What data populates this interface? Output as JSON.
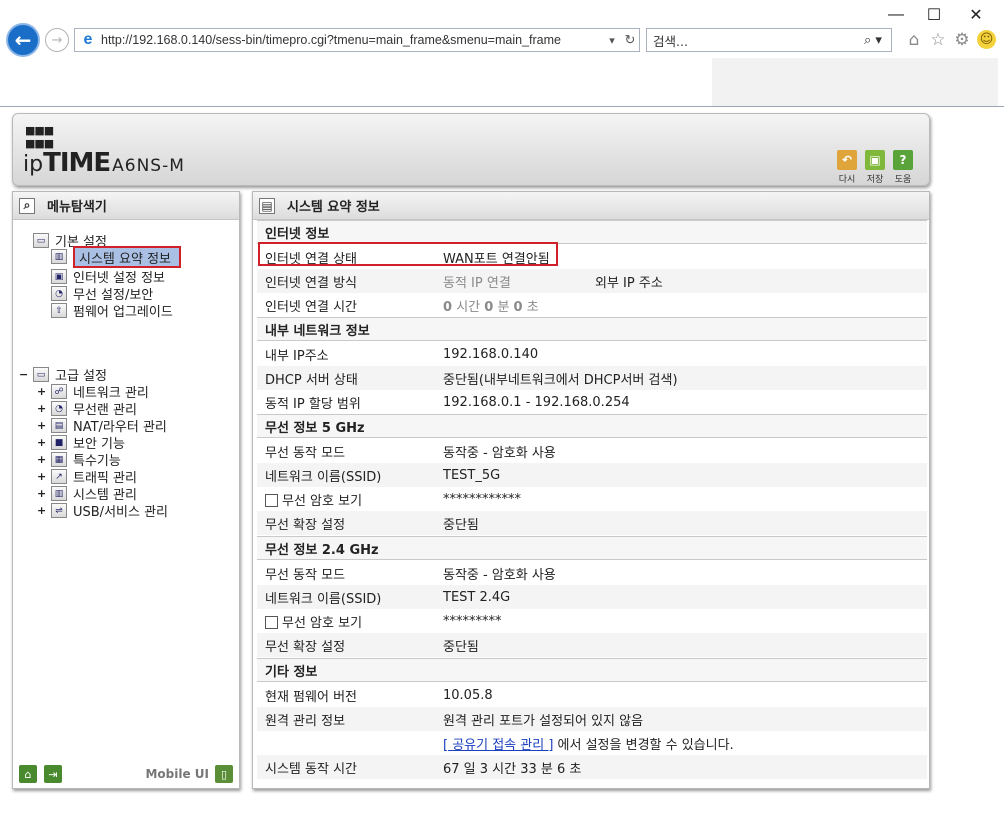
{
  "browser": {
    "url": "http://192.168.0.140/sess-bin/timepro.cgi?tmenu=main_frame&smenu=main_frame",
    "search_placeholder": "검색...",
    "window_controls": [
      "—",
      "☐",
      "✕"
    ]
  },
  "header": {
    "logo_ip": "ip",
    "logo_time": "TIME",
    "logo_model": "A6NS-M",
    "buttons": [
      {
        "label": "다시",
        "icon": "undo-icon",
        "color": "#e0a53a"
      },
      {
        "label": "저장",
        "icon": "save-icon",
        "color": "#7fb83a"
      },
      {
        "label": "도움",
        "icon": "help-icon",
        "color": "#5aa33a"
      }
    ]
  },
  "left_panel": {
    "title": "메뉴탐색기",
    "basic": {
      "label": "기본 설정",
      "items": [
        "시스템 요약 정보",
        "인터넷 설정 정보",
        "무선 설정/보안",
        "펌웨어 업그레이드"
      ]
    },
    "advanced": {
      "label": "고급 설정",
      "items": [
        "네트워크 관리",
        "무선랜 관리",
        "NAT/라우터 관리",
        "보안 기능",
        "특수기능",
        "트래픽 관리",
        "시스템 관리",
        "USB/서비스 관리"
      ]
    },
    "footer": {
      "mobile_ui": "Mobile UI"
    }
  },
  "right_panel": {
    "title": "시스템 요약 정보",
    "internet": {
      "title": "인터넷 정보",
      "status_label": "인터넷 연결 상태",
      "status_value": "WAN포트 연결안됨",
      "method_label": "인터넷 연결 방식",
      "method_value": "동적 IP 연결",
      "external_ip_label": "외부 IP 주소",
      "time_label": "인터넷 연결 시간",
      "time_h": "0",
      "time_h_unit": "시간",
      "time_m": "0",
      "time_m_unit": "분",
      "time_s": "0",
      "time_s_unit": "초"
    },
    "lan": {
      "title": "내부 네트워크 정보",
      "ip_label": "내부 IP주소",
      "ip_value": "192.168.0.140",
      "dhcp_label": "DHCP 서버 상태",
      "dhcp_value": "중단됨(내부네트워크에서 DHCP서버 검색)",
      "range_label": "동적 IP 할당 범위",
      "range_value": "192.168.0.1 -  192.168.0.254"
    },
    "wifi5": {
      "title": "무선 정보 5 GHz",
      "mode_label": "무선 동작 모드",
      "mode_value": "동작중 - 암호화 사용",
      "ssid_label": "네트워크 이름(SSID)",
      "ssid_value": "TEST_5G",
      "pw_label": "무선 암호 보기",
      "pw_value": "************",
      "ext_label": "무선 확장 설정",
      "ext_value": "중단됨"
    },
    "wifi24": {
      "title": "무선 정보 2.4 GHz",
      "mode_label": "무선 동작 모드",
      "mode_value": "동작중 - 암호화 사용",
      "ssid_label": "네트워크 이름(SSID)",
      "ssid_value": "TEST 2.4G",
      "pw_label": "무선 암호 보기",
      "pw_value": "*********",
      "ext_label": "무선 확장 설정",
      "ext_value": "중단됨"
    },
    "etc": {
      "title": "기타 정보",
      "fw_label": "현재 펌웨어 버전",
      "fw_value": "10.05.8",
      "remote_label": "원격 관리 정보",
      "remote_value": "원격 관리 포트가 설정되어 있지 않음",
      "remote_link": "[ 공유기 접속 관리 ]",
      "remote_note": " 에서 설정을 변경할 수 있습니다.",
      "uptime_label": "시스템 동작 시간",
      "uptime_value": "67 일 3 시간 33 분 6 초"
    }
  }
}
